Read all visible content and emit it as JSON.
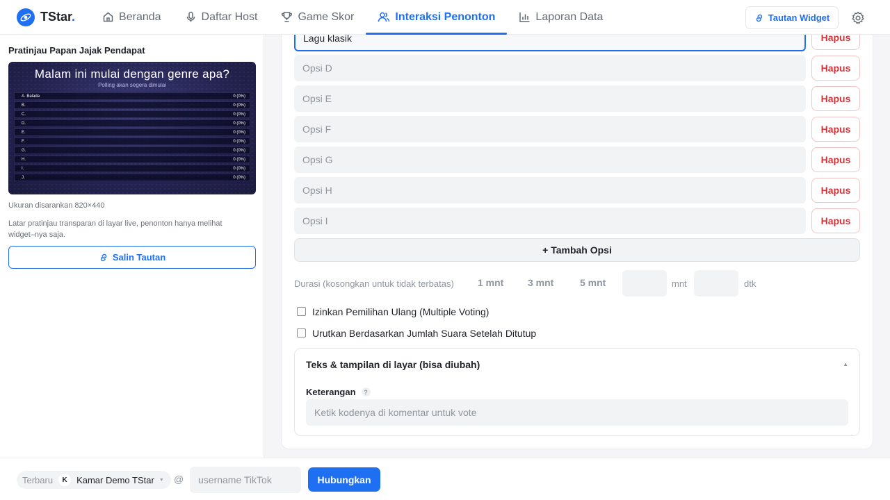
{
  "brand": {
    "name": "TStar",
    "dot": "."
  },
  "nav": {
    "items": [
      {
        "label": "Beranda",
        "icon": "home-icon"
      },
      {
        "label": "Daftar Host",
        "icon": "microphone-icon"
      },
      {
        "label": "Game Skor",
        "icon": "trophy-icon"
      },
      {
        "label": "Interaksi Penonton",
        "icon": "users-icon",
        "active": true
      },
      {
        "label": "Laporan Data",
        "icon": "bar-chart-icon"
      }
    ],
    "widget_link_label": "Tautan Widget"
  },
  "colors": {
    "accent": "#1e6ff2",
    "danger": "#d3363a"
  },
  "left": {
    "title": "Pratinjau Papan Jajak Pendapat",
    "preview": {
      "question": "Malam ini mulai dengan genre apa?",
      "status": "Polling akan segera dimulai",
      "rows": [
        {
          "label": "A. Balada",
          "value": "0 (0%)"
        },
        {
          "label": "B.",
          "value": "0 (0%)"
        },
        {
          "label": "C.",
          "value": "0 (0%)"
        },
        {
          "label": "D.",
          "value": "0 (0%)"
        },
        {
          "label": "E.",
          "value": "0 (0%)"
        },
        {
          "label": "F.",
          "value": "0 (0%)"
        },
        {
          "label": "G.",
          "value": "0 (0%)"
        },
        {
          "label": "H.",
          "value": "0 (0%)"
        },
        {
          "label": "I.",
          "value": "0 (0%)"
        },
        {
          "label": "J.",
          "value": "0 (0%)"
        }
      ]
    },
    "size_hint": "Ukuran disarankan 820×440",
    "description": "Latar pratinjau transparan di layar live, penonton hanya melihat widget–nya saja.",
    "copy_link_label": "Salin Tautan"
  },
  "options": {
    "items": [
      {
        "value": "Lagu klasik",
        "placeholder": ""
      },
      {
        "value": "",
        "placeholder": "Opsi D"
      },
      {
        "value": "",
        "placeholder": "Opsi E"
      },
      {
        "value": "",
        "placeholder": "Opsi F"
      },
      {
        "value": "",
        "placeholder": "Opsi G"
      },
      {
        "value": "",
        "placeholder": "Opsi H"
      },
      {
        "value": "",
        "placeholder": "Opsi I"
      }
    ],
    "delete_label": "Hapus",
    "add_label": "+ Tambah Opsi"
  },
  "duration": {
    "label": "Durasi (kosongkan untuk tidak terbatas)",
    "presets": [
      "1 mnt",
      "3 mnt",
      "5 mnt"
    ],
    "minutes_value": "",
    "minutes_unit": "mnt",
    "seconds_value": "",
    "seconds_unit": "dtk"
  },
  "checkboxes": [
    {
      "label": "Izinkan Pemilihan Ulang (Multiple Voting)",
      "checked": false
    },
    {
      "label": "Urutkan Berdasarkan Jumlah Suara Setelah Ditutup",
      "checked": false
    }
  ],
  "display_section": {
    "title": "Teks & tampilan di layar (bisa diubah)",
    "caret": "▲",
    "keterangan_label": "Keterangan",
    "help": "?",
    "keterangan_value": "Ketik kodenya di komentar untuk vote"
  },
  "bottom": {
    "latest_label": "Terbaru",
    "room_badge": "K",
    "room_name": "Kamar Demo TStar",
    "at": "@",
    "username_placeholder": "username TikTok",
    "connect_label": "Hubungkan"
  }
}
